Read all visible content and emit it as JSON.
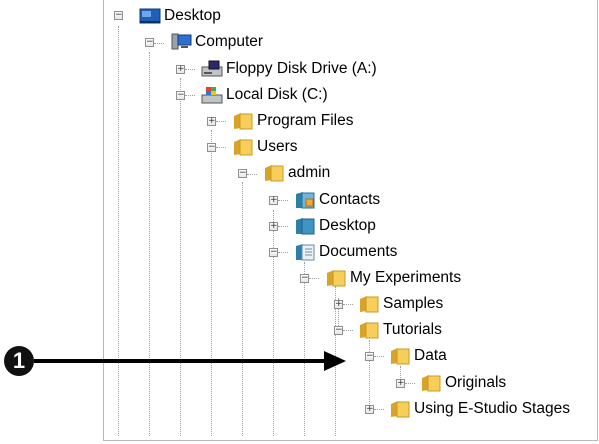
{
  "tree": {
    "nodes": [
      {
        "label": "Desktop"
      },
      {
        "label": "Computer"
      },
      {
        "label": "Floppy Disk Drive (A:)"
      },
      {
        "label": "Local Disk (C:)"
      },
      {
        "label": "Program Files"
      },
      {
        "label": "Users"
      },
      {
        "label": "admin"
      },
      {
        "label": "Contacts"
      },
      {
        "label": "Desktop"
      },
      {
        "label": "Documents"
      },
      {
        "label": "My Experiments"
      },
      {
        "label": "Samples"
      },
      {
        "label": "Tutorials"
      },
      {
        "label": "Data"
      },
      {
        "label": "Originals"
      },
      {
        "label": "Using E-Studio Stages"
      }
    ]
  },
  "callout": {
    "number": "1"
  }
}
